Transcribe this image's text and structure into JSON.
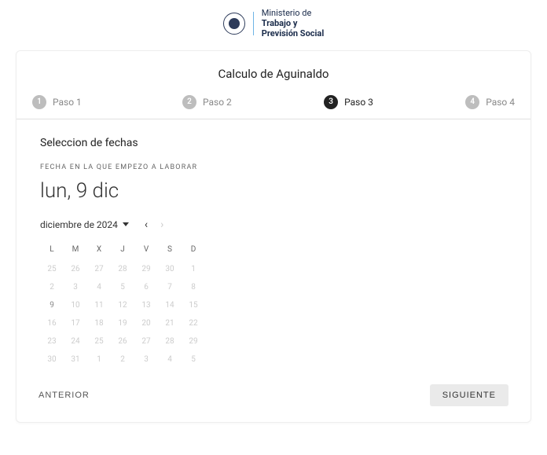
{
  "header": {
    "ministry_line1": "Ministerio de",
    "ministry_line2": "Trabajo y",
    "ministry_line3": "Previsión Social"
  },
  "title": "Calculo de Aguinaldo",
  "steps": [
    {
      "num": "1",
      "label": "Paso 1",
      "active": false
    },
    {
      "num": "2",
      "label": "Paso 2",
      "active": false
    },
    {
      "num": "3",
      "label": "Paso 3",
      "active": true
    },
    {
      "num": "4",
      "label": "Paso 4",
      "active": false
    }
  ],
  "section_title": "Seleccion de fechas",
  "field_label": "FECHA EN LA QUE EMPEZO A LABORAR",
  "selected_date_display": "lun, 9 dic",
  "month_label": "diciembre de 2024",
  "weekdays": [
    "L",
    "M",
    "X",
    "J",
    "V",
    "S",
    "D"
  ],
  "calendar_grid": [
    [
      "25",
      "26",
      "27",
      "28",
      "29",
      "30",
      "1"
    ],
    [
      "2",
      "3",
      "4",
      "5",
      "6",
      "7",
      "8"
    ],
    [
      "9",
      "10",
      "11",
      "12",
      "13",
      "14",
      "15"
    ],
    [
      "16",
      "17",
      "18",
      "19",
      "20",
      "21",
      "22"
    ],
    [
      "23",
      "24",
      "25",
      "26",
      "27",
      "28",
      "29"
    ],
    [
      "30",
      "31",
      "1",
      "2",
      "3",
      "4",
      "5"
    ]
  ],
  "selected_day": "9",
  "selected_row": 2,
  "selected_col": 0,
  "buttons": {
    "prev": "ANTERIOR",
    "next": "SIGUIENTE"
  }
}
